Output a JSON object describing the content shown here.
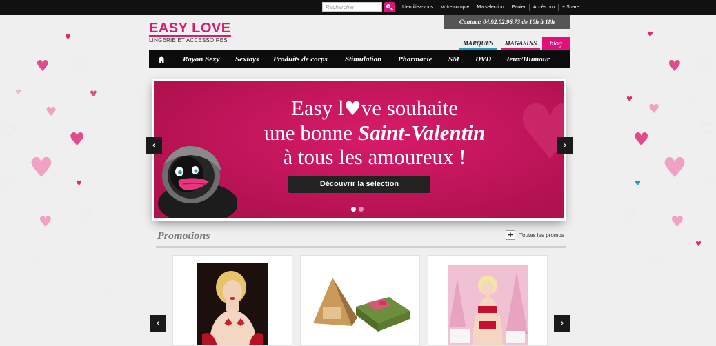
{
  "topbar": {
    "search_placeholder": "Rechercher",
    "links": [
      "Identifiez-vous",
      "Votre compte",
      "Ma selection",
      "Panier",
      "Accès pro",
      "+ Share"
    ]
  },
  "logo": {
    "title": "EASY LOVE",
    "subtitle": "LINGERIE ET ACCESSOIRES"
  },
  "contact": {
    "text": "Contact: 04.92.02.96.73   de 10h à 18h"
  },
  "brand_tabs": {
    "marques": "MARQUES",
    "magasins": "MAGASINS",
    "blog": "blog"
  },
  "nav": {
    "items": [
      "Rayon Sexy",
      "Sextoys",
      "Produits de corps",
      "Stimulation",
      "Pharmacie",
      "SM",
      "DVD",
      "Jeux/Humour"
    ]
  },
  "slider": {
    "line1_pre": "Easy l",
    "line1_post": "ve souhaite",
    "line2_pre": "une bonne ",
    "line2_script": "Saint-Valentin",
    "line3": "à tous les amoureux !",
    "cta": "Découvrir la sélection",
    "slides": 2,
    "active_slide": 1
  },
  "promotions": {
    "title": "Promotions",
    "all_link": "Toutes les promos"
  },
  "colors": {
    "brand_pink": "#d81b72",
    "teal": "#1e9fb5",
    "slide_bg": "#c2145d"
  },
  "icons": [
    "home-icon",
    "search-icon",
    "plus-icon",
    "chevron-left-icon",
    "chevron-right-icon"
  ]
}
